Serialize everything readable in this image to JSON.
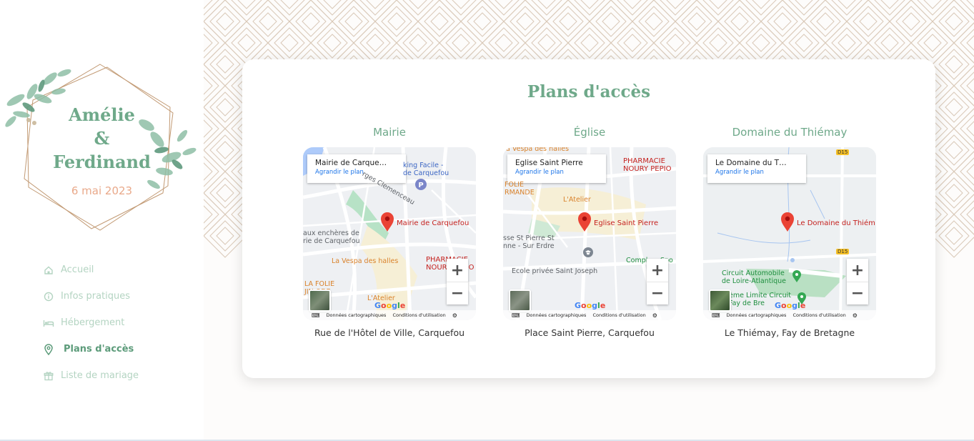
{
  "brand": {
    "name1": "Amélie",
    "amp": "&",
    "name2": "Ferdinand",
    "date": "6 mai 2023"
  },
  "nav": [
    {
      "label": "Accueil",
      "icon": "home-icon"
    },
    {
      "label": "Infos pratiques",
      "icon": "info-icon"
    },
    {
      "label": "Hébergement",
      "icon": "bed-icon"
    },
    {
      "label": "Plans d'accès",
      "icon": "location-pin-icon",
      "active": true
    },
    {
      "label": "Liste de mariage",
      "icon": "gift-icon"
    }
  ],
  "page": {
    "title": "Plans d'accès"
  },
  "places": [
    {
      "heading": "Mairie",
      "map_title": "Mairie de Carque…",
      "map_link": "Agrandir le plan",
      "address": "Rue de l'Hôtel de Ville, Carquefou",
      "pin_label": "Mairie de Carquefou",
      "labels": [
        "king Facile -",
        "de Carquefou",
        "rges Clemenceau",
        "aux enchères de",
        "rie de Carquefou",
        "La Vespa des halles",
        "PHARMACIE",
        "NOURY PEPIO",
        "LA FOLIE",
        "JIN ODE",
        "L'Atelier"
      ]
    },
    {
      "heading": "Église",
      "map_title": "Eglise Saint Pierre",
      "map_link": "Agrandir le plan",
      "address": "Place Saint Pierre, Carquefou",
      "pin_label": "Eglise Saint Pierre",
      "labels": [
        "a Vespa des halles",
        "PHARMACIE",
        "NOURY PEPIO",
        "FOLIE",
        "RMANDE",
        "L'Atelier",
        "sse St Pierre St",
        "nne - Sur Erdre",
        "Ecole privée Saint Joseph",
        "Compl",
        "Spo",
        "J"
      ]
    },
    {
      "heading": "Domaine du Thiémay",
      "map_title": "Le Domaine du T…",
      "map_link": "Agrandir le plan",
      "address": "Le Thiémay, Fay de Bretagne",
      "pin_label": "Le Domaine du Thiém",
      "labels": [
        "D15",
        "D15",
        "Circuit Automobile",
        "de Loire-Atlantique",
        "ème Limite Circuit",
        "Fay de Bre"
      ]
    }
  ],
  "map_footer": {
    "data": "Données cartographiques",
    "terms": "Conditions d'utilisation",
    "zoom_in": "+",
    "zoom_out": "−",
    "google": "Google"
  },
  "colors": {
    "accent": "#6fa98a",
    "date": "#e9a98a",
    "pattern": "#d9c9b8"
  }
}
